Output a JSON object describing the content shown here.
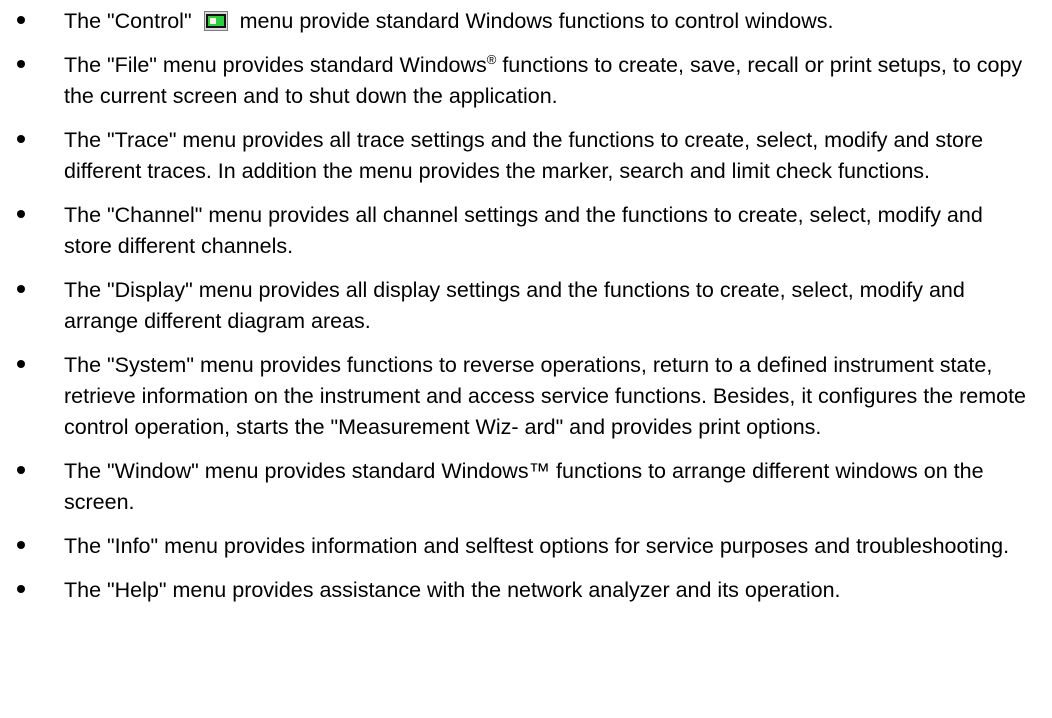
{
  "items": [
    {
      "before": "The \"Control\"",
      "icon": "control-menu-icon",
      "after": "menu provide standard Windows functions to control windows."
    },
    {
      "before": "The \"File\" menu provides standard Windows",
      "sup": "®",
      "after": " functions to create, save, recall or print setups, to copy the current screen and to shut down the application."
    },
    {
      "text": "The \"Trace\" menu provides all trace settings and the functions to create, select, modify and store different traces. In addition the menu provides the marker, search and limit check functions."
    },
    {
      "text": "The \"Channel\" menu provides all channel settings and the functions to create, select, modify and store different channels."
    },
    {
      "text": "The \"Display\" menu provides all display settings and the functions to create, select, modify and arrange different diagram areas."
    },
    {
      "text": "The \"System\" menu provides functions to reverse operations, return to a defined instrument state, retrieve information on the instrument and access service functions. Besides, it configures the remote control operation, starts the \"Measurement Wiz- ard\" and provides print options."
    },
    {
      "text": "The \"Window\" menu provides standard Windows™ functions to arrange different windows on the screen."
    },
    {
      "text": "The \"Info\" menu provides information and selftest options for service purposes and troubleshooting."
    },
    {
      "text": "The \"Help\" menu provides assistance with the network analyzer and its operation."
    }
  ]
}
